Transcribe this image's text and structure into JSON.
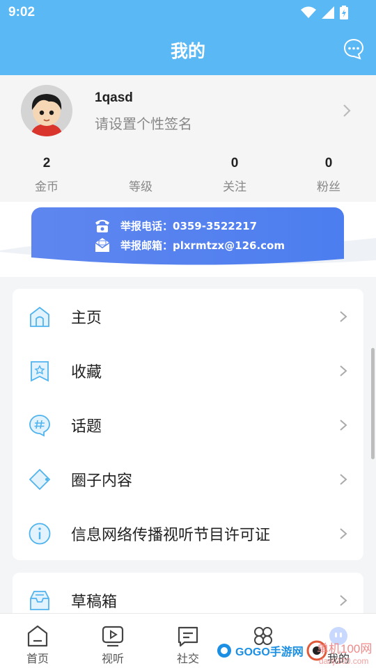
{
  "status_bar": {
    "time": "9:02"
  },
  "header": {
    "title": "我的"
  },
  "profile": {
    "username": "1qasd",
    "signature": "请设置个性签名",
    "stats": [
      {
        "value": "2",
        "label": "金币"
      },
      {
        "value": "",
        "label": "等级"
      },
      {
        "value": "0",
        "label": "关注"
      },
      {
        "value": "0",
        "label": "粉丝"
      }
    ]
  },
  "banner": {
    "phone_text": "举报电话：0359-3522217",
    "email_text": "举报邮箱：plxrmtzx@126.com"
  },
  "menu": {
    "items": [
      {
        "label": "主页",
        "icon": "home-icon"
      },
      {
        "label": "收藏",
        "icon": "bookmark-icon"
      },
      {
        "label": "话题",
        "icon": "topic-hashtag-icon"
      },
      {
        "label": "圈子内容",
        "icon": "circle-diamond-icon"
      },
      {
        "label": "信息网络传播视听节目许可证",
        "icon": "info-icon"
      }
    ],
    "items2": [
      {
        "label": "草稿箱",
        "icon": "drafts-box-icon"
      }
    ]
  },
  "bottom_nav": {
    "tabs": [
      {
        "label": "首页",
        "icon": "home-tab-icon"
      },
      {
        "label": "视听",
        "icon": "video-tab-icon"
      },
      {
        "label": "社交",
        "icon": "social-tab-icon"
      },
      {
        "label": "",
        "icon": "clover-tab-icon"
      },
      {
        "label": "我的",
        "icon": "profile-tab-icon"
      }
    ]
  },
  "watermarks": {
    "left": "GOGO手游网",
    "right": "单机100网",
    "right_url": "danji100.com"
  },
  "colors": {
    "header_bg": "#5ab8f5",
    "banner_gradient_start": "#5b86f0",
    "banner_gradient_end": "#4e7fef",
    "icon_blue": "#4fb3ee"
  }
}
